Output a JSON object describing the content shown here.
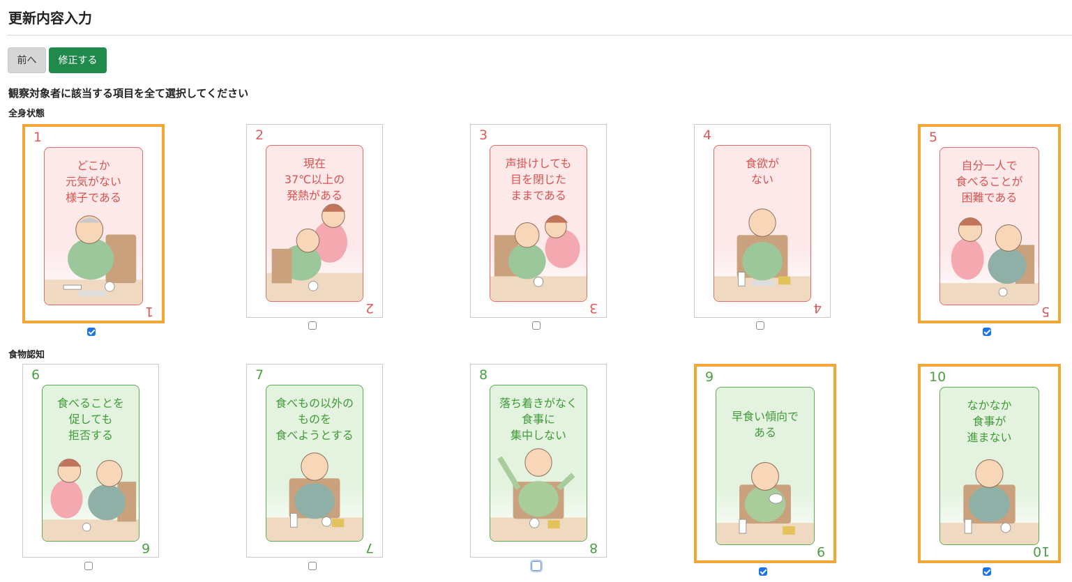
{
  "page": {
    "title": "更新内容入力"
  },
  "toolbar": {
    "prev_label": "前へ",
    "edit_label": "修正する"
  },
  "instruction": "観察対象者に該当する項目を全て選択してください",
  "sections": [
    {
      "label": "全身状態",
      "color": "#e05a5a",
      "cards": [
        {
          "num": "1",
          "text": "どこか\n元気がない\n様子である",
          "checked": true
        },
        {
          "num": "2",
          "text": "現在\n37℃以上の\n発熱がある",
          "checked": false
        },
        {
          "num": "3",
          "text": "声掛けしても\n目を閉じた\nままである",
          "checked": false
        },
        {
          "num": "4",
          "text": "食欲が\nない",
          "checked": false
        },
        {
          "num": "5",
          "text": "自分一人で\n食べることが\n困難である",
          "checked": true
        }
      ]
    },
    {
      "label": "食物認知",
      "color": "#4a9f43",
      "cards": [
        {
          "num": "6",
          "text": "食べることを\n促しても\n拒否する",
          "checked": false
        },
        {
          "num": "7",
          "text": "食べもの以外の\nものを\n食べようとする",
          "checked": false
        },
        {
          "num": "8",
          "text": "落ち着きがなく\n食事に\n集中しない",
          "checked": false
        },
        {
          "num": "9",
          "text": "早食い傾向で\nある",
          "checked": true
        },
        {
          "num": "10",
          "text": "なかなか\n食事が\n進まない",
          "checked": true
        }
      ]
    }
  ]
}
